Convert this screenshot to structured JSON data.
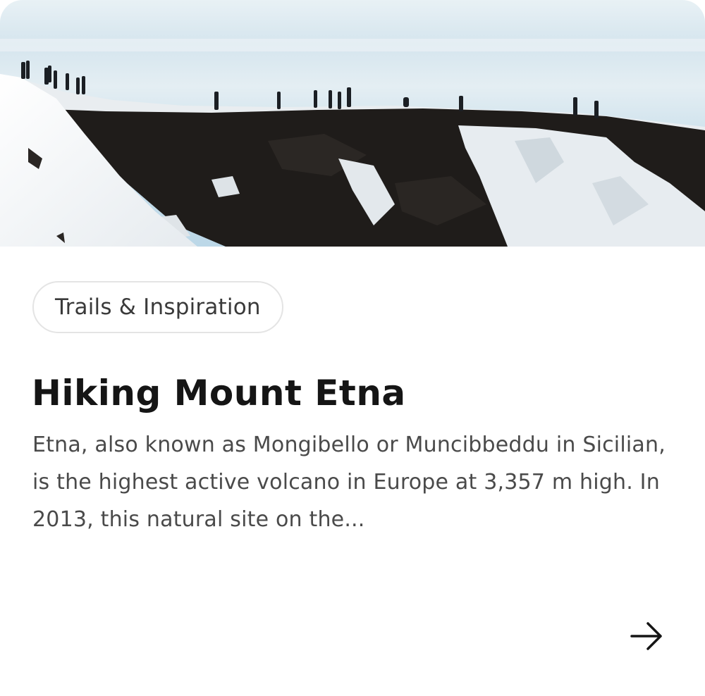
{
  "card": {
    "tag_label": "Trails & Inspiration",
    "title": "Hiking Mount Etna",
    "description": "Etna, also known as Mongibello or Muncibbeddu in Sicilian, is the highest active volcano in Europe at 3,357 m high. In 2013, this natural site on the...",
    "arrow_icon": "arrow-right-icon"
  },
  "colors": {
    "title": "#151515",
    "text": "#4a4a4a",
    "tag_border": "#e4e4e4",
    "sky": "#cfe2ec",
    "rock": "#1c1a18",
    "snow": "#f4f6f8"
  }
}
